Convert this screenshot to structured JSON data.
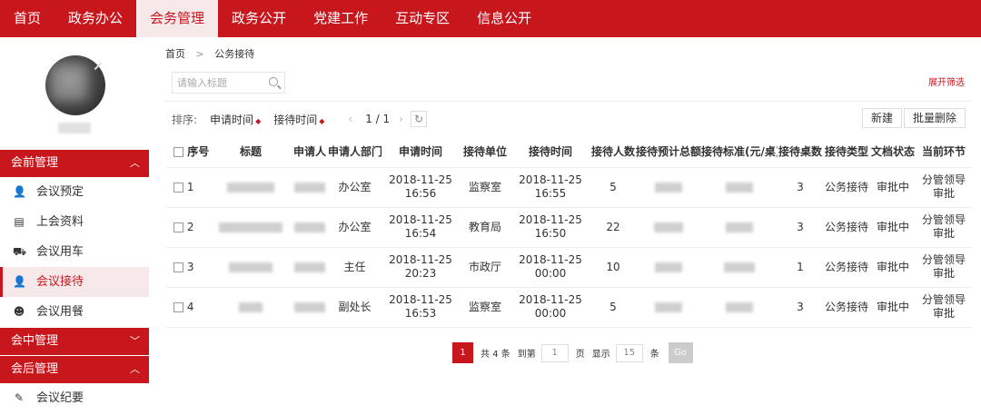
{
  "topnav": {
    "items": [
      "首页",
      "政务办公",
      "会务管理",
      "政务公开",
      "党建工作",
      "互动专区",
      "信息公开"
    ],
    "active_index": 2
  },
  "sidebar": {
    "groups": [
      {
        "label": "会前管理",
        "expanded": true,
        "items": [
          {
            "label": "会议预定",
            "icon": "user-edit-icon"
          },
          {
            "label": "上会资料",
            "icon": "document-icon"
          },
          {
            "label": "会议用车",
            "icon": "car-icon"
          },
          {
            "label": "会议接待",
            "icon": "user-icon",
            "active": true
          },
          {
            "label": "会议用餐",
            "icon": "smile-icon"
          }
        ]
      },
      {
        "label": "会中管理",
        "expanded": false,
        "items": []
      },
      {
        "label": "会后管理",
        "expanded": true,
        "items": [
          {
            "label": "会议纪要",
            "icon": "pen-icon"
          }
        ]
      }
    ]
  },
  "breadcrumb": {
    "home": "首页",
    "sep": ">",
    "current": "公务接待"
  },
  "search": {
    "placeholder": "请输入标题",
    "value": ""
  },
  "expand_filter": "展开筛选",
  "toolbar": {
    "sort_label": "排序:",
    "sort_fields": [
      "申请时间",
      "接待时间"
    ],
    "sort_arrow": "◆",
    "prev": "‹",
    "next": "›",
    "page_info": "1 / 1",
    "refresh": "↻",
    "new_button": "新建",
    "batch_delete_button": "批量删除"
  },
  "table": {
    "columns": [
      "序号",
      "标题",
      "申请人",
      "申请人部门",
      "申请时间",
      "接待单位",
      "接待时间",
      "接待人数",
      "接待预计总额",
      "接待标准(元/桌)",
      "接待桌数",
      "接待类型",
      "文档状态",
      "当前环节"
    ],
    "rows": [
      {
        "no": "1",
        "dept": "办公室",
        "apply_time": "2018-11-25 16:56",
        "unit": "监察室",
        "reception_time": "2018-11-25 16:55",
        "people": "5",
        "tables": "3",
        "type": "公务接待",
        "status": "审批中",
        "step": "分管领导审批"
      },
      {
        "no": "2",
        "dept": "办公室",
        "apply_time": "2018-11-25 16:54",
        "unit": "教育局",
        "reception_time": "2018-11-25 16:50",
        "people": "22",
        "tables": "3",
        "type": "公务接待",
        "status": "审批中",
        "step": "分管领导审批"
      },
      {
        "no": "3",
        "dept": "主任",
        "apply_time": "2018-11-25 20:23",
        "unit": "市政厅",
        "reception_time": "2018-11-25 00:00",
        "people": "10",
        "tables": "1",
        "type": "公务接待",
        "status": "审批中",
        "step": "分管领导审批"
      },
      {
        "no": "4",
        "dept": "副处长",
        "apply_time": "2018-11-25 16:53",
        "unit": "监察室",
        "reception_time": "2018-11-25 00:00",
        "people": "5",
        "tables": "3",
        "type": "公务接待",
        "status": "审批中",
        "step": "分管领导审批"
      }
    ]
  },
  "pager": {
    "current": "1",
    "total_text": "共 4 条",
    "goto_text": "到第",
    "goto_value": "1",
    "page_unit": "页",
    "show_text": "显示",
    "page_size": "15",
    "size_unit": "条",
    "go": "Go"
  },
  "colors": {
    "brand": "#c8161d",
    "active_bg": "#f7e9e9"
  }
}
